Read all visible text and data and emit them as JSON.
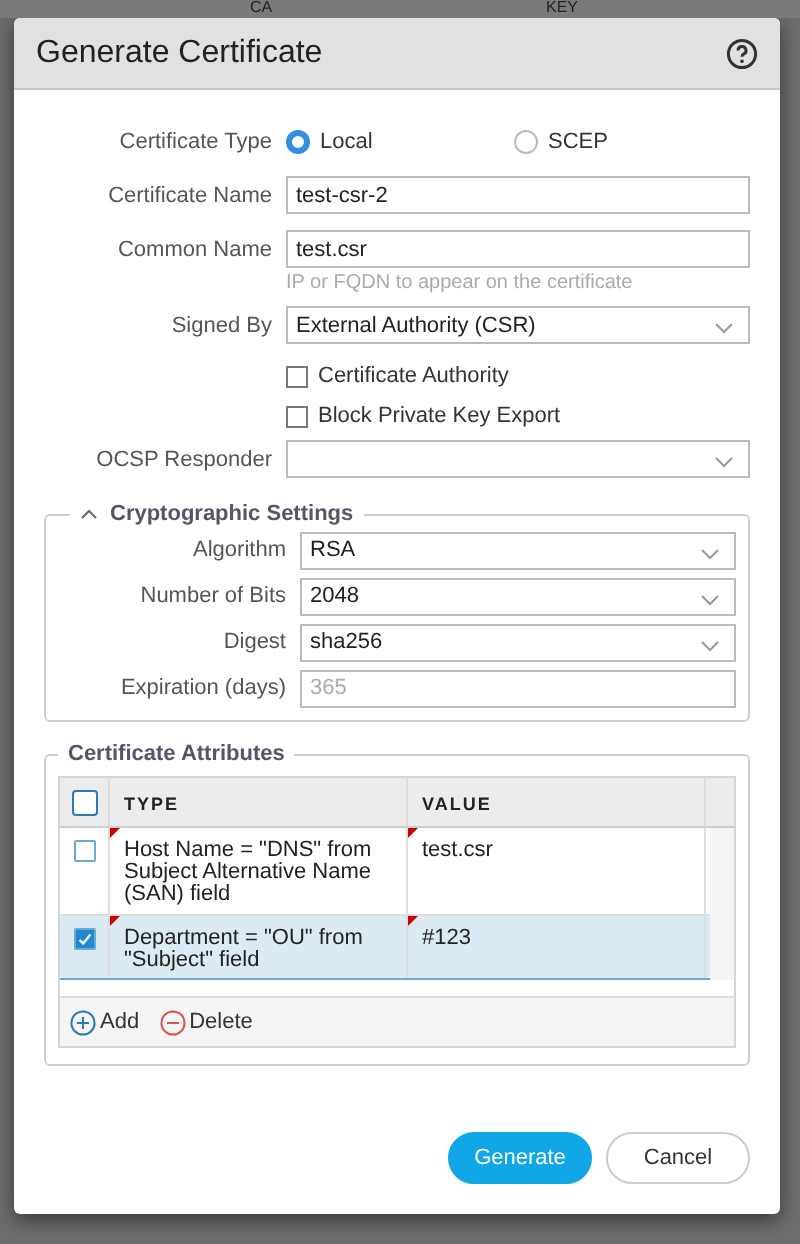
{
  "background_table": {
    "columns": [
      "CA",
      "KEY"
    ]
  },
  "dialog": {
    "title": "Generate Certificate"
  },
  "certificate_type": {
    "label": "Certificate Type",
    "options": [
      {
        "label": "Local",
        "selected": true
      },
      {
        "label": "SCEP",
        "selected": false
      }
    ]
  },
  "certificate_name": {
    "label": "Certificate Name",
    "value": "test-csr-2"
  },
  "common_name": {
    "label": "Common Name",
    "value": "test.csr",
    "hint": "IP or FQDN to appear on the certificate"
  },
  "signed_by": {
    "label": "Signed By",
    "value": "External Authority (CSR)"
  },
  "checkboxes": [
    {
      "label": "Certificate Authority",
      "checked": false
    },
    {
      "label": "Block Private Key Export",
      "checked": false
    }
  ],
  "ocsp_responder": {
    "label": "OCSP Responder"
  },
  "crypto": {
    "title": "Cryptographic Settings",
    "expanded": true,
    "fields": [
      {
        "kind": "select",
        "label": "Algorithm",
        "value": "RSA"
      },
      {
        "kind": "select",
        "label": "Number of Bits",
        "value": "2048"
      },
      {
        "kind": "select",
        "label": "Digest",
        "value": "sha256"
      },
      {
        "kind": "input",
        "label": "Expiration (days)",
        "placeholder": "365"
      }
    ]
  },
  "attributes": {
    "title": "Certificate Attributes",
    "all_selected": false,
    "columns": [
      "TYPE",
      "VALUE"
    ],
    "rows": [
      {
        "type": "Host Name = \"DNS\" from Subject Alternative Name (SAN) field",
        "value": "test.csr",
        "selected": false
      },
      {
        "type": "Department = \"OU\" from \"Subject\" field",
        "value": "#123",
        "selected": true
      }
    ],
    "actions": [
      "Add",
      "Delete"
    ]
  },
  "buttons": [
    "Generate",
    "Cancel"
  ]
}
